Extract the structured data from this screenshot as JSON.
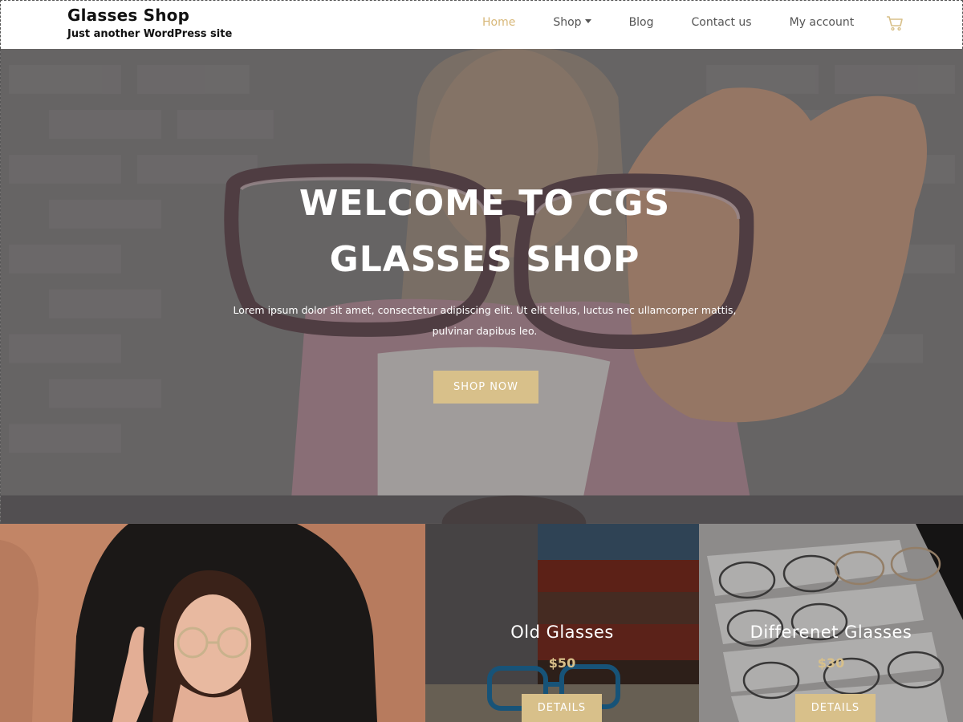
{
  "header": {
    "site_title": "Glasses Shop",
    "tagline": "Just another WordPress site",
    "nav": [
      {
        "label": "Home",
        "active": true
      },
      {
        "label": "Shop",
        "has_dropdown": true
      },
      {
        "label": "Blog"
      },
      {
        "label": "Contact us"
      },
      {
        "label": "My account"
      }
    ],
    "cart_icon": "cart-icon"
  },
  "hero": {
    "title_line1": "WELCOME TO CGS",
    "title_line2": "GLASSES SHOP",
    "text_line1": "Lorem ipsum dolor sit amet, consectetur adipiscing elit. Ut elit tellus, luctus nec ullamcorper mattis,",
    "text_line2": "pulvinar dapibus leo.",
    "button": "SHOP NOW"
  },
  "products": [
    {
      "name": "Old Glasses",
      "price": "$50",
      "button": "DETAILS"
    },
    {
      "name": "Differenet Glasses",
      "price": "$30",
      "button": "DETAILS"
    }
  ],
  "colors": {
    "accent": "#d8c08a",
    "nav_active": "#d8b87a",
    "nav_text": "#555555"
  }
}
